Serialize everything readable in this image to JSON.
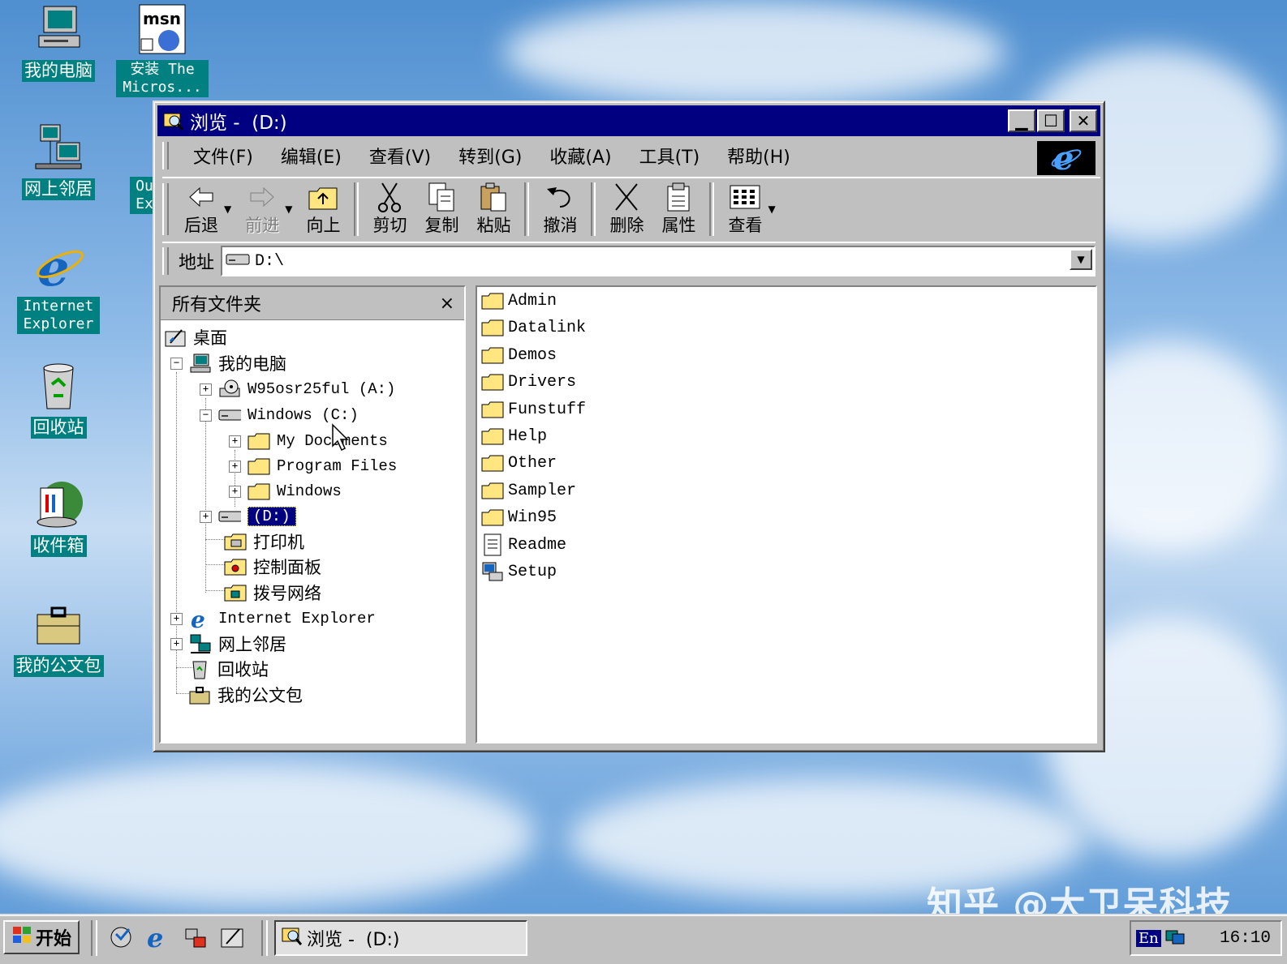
{
  "desktop": {
    "icons": [
      {
        "label": "我的电脑",
        "icon": "my-computer-icon"
      },
      {
        "label": "安装 The Micros...",
        "icon": "msn-setup-icon"
      },
      {
        "label": "网上邻居",
        "icon": "network-neighborhood-icon"
      },
      {
        "label": "Internet Explorer",
        "icon": "internet-explorer-icon"
      },
      {
        "label": "回收站",
        "icon": "recycle-bin-icon"
      },
      {
        "label": "收件箱",
        "icon": "inbox-icon"
      },
      {
        "label": "我的公文包",
        "icon": "briefcase-icon"
      }
    ],
    "partial_label": "Ou Ex"
  },
  "window": {
    "title": "浏览 -  (D:)",
    "menu": [
      "文件(F)",
      "编辑(E)",
      "查看(V)",
      "转到(G)",
      "收藏(A)",
      "工具(T)",
      "帮助(H)"
    ],
    "toolbar": {
      "back": "后退",
      "forward": "前进",
      "up": "向上",
      "cut": "剪切",
      "copy": "复制",
      "paste": "粘贴",
      "undo": "撤消",
      "delete": "删除",
      "properties": "属性",
      "views": "查看"
    },
    "address": {
      "label": "地址",
      "value": "D:\\"
    },
    "folders_pane": {
      "title": "所有文件夹",
      "close": "×",
      "tree": {
        "desktop": "桌面",
        "my_computer": "我的电脑",
        "drive_a": "W95osr25ful (A:)",
        "drive_c": "Windows (C:)",
        "my_documents": "My Documents",
        "program_files": "Program Files",
        "windows": "Windows",
        "drive_d": "(D:)",
        "printers": "打印机",
        "control_panel": "控制面板",
        "dialup": "拨号网络",
        "internet_explorer": "Internet Explorer",
        "network": "网上邻居",
        "recycle_bin": "回收站",
        "briefcase": "我的公文包"
      }
    },
    "files": [
      {
        "name": "Admin",
        "type": "folder"
      },
      {
        "name": "Datalink",
        "type": "folder"
      },
      {
        "name": "Demos",
        "type": "folder"
      },
      {
        "name": "Drivers",
        "type": "folder"
      },
      {
        "name": "Funstuff",
        "type": "folder"
      },
      {
        "name": "Help",
        "type": "folder"
      },
      {
        "name": "Other",
        "type": "folder"
      },
      {
        "name": "Sampler",
        "type": "folder"
      },
      {
        "name": "Win95",
        "type": "folder"
      },
      {
        "name": "Readme",
        "type": "text"
      },
      {
        "name": "Setup",
        "type": "setup"
      }
    ]
  },
  "taskbar": {
    "start": "开始",
    "task": "浏览 -  (D:)",
    "lang": "En",
    "clock": "16:10"
  },
  "watermark": "知乎 @大卫呆科技",
  "colors": {
    "titlebar": "#000080",
    "desktop": "#008080",
    "face": "#c0c0c0"
  }
}
